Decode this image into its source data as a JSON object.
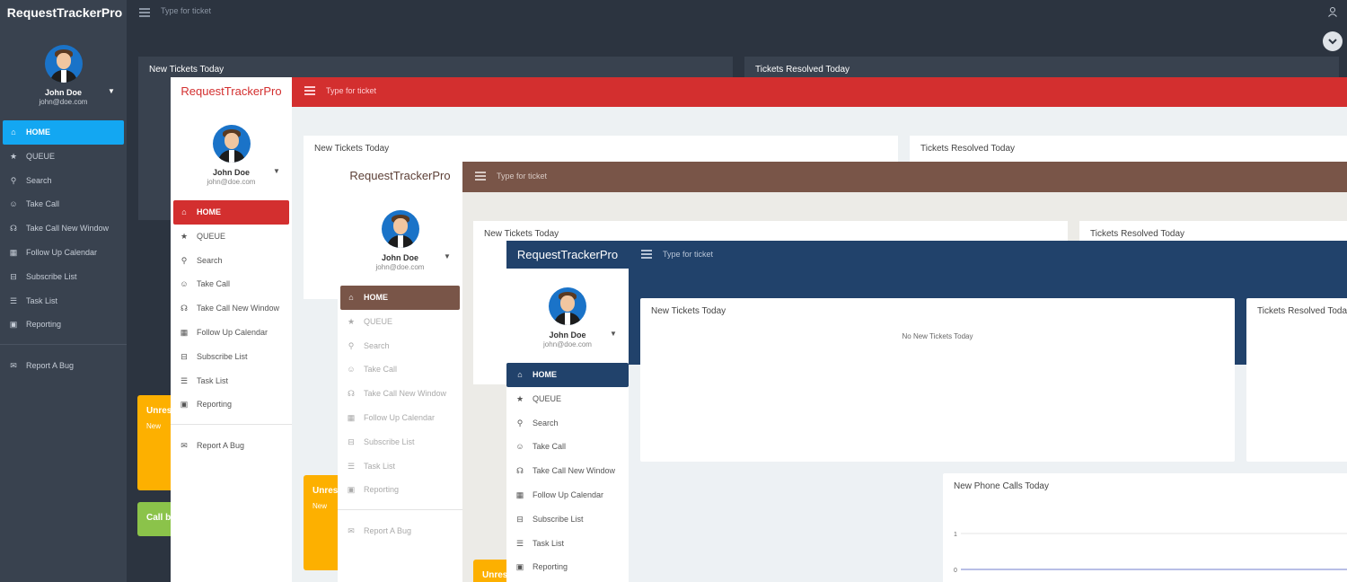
{
  "app": {
    "title": "RequestTrackerPro",
    "search_placeholder": "Type for ticket"
  },
  "user": {
    "name": "John Doe",
    "email": "john@doe.com"
  },
  "nav": {
    "items": [
      {
        "label": "HOME",
        "icon": "home-icon"
      },
      {
        "label": "QUEUE",
        "icon": "star-icon"
      },
      {
        "label": "Search",
        "icon": "search-icon"
      },
      {
        "label": "Take Call",
        "icon": "user-icon"
      },
      {
        "label": "Take Call New Window",
        "icon": "headset-icon"
      },
      {
        "label": "Follow Up Calendar",
        "icon": "calendar-icon"
      },
      {
        "label": "Subscribe List",
        "icon": "inbox-icon"
      },
      {
        "label": "Task List",
        "icon": "list-icon"
      },
      {
        "label": "Reporting",
        "icon": "briefcase-icon"
      }
    ],
    "report_bug": "Report A Bug"
  },
  "cards": {
    "new_tickets_title": "New Tickets Today",
    "resolved_title": "Tickets Resolved Today",
    "no_new_tickets": "No New Tickets Today",
    "phone_calls_title": "New Phone Calls Today",
    "unresolved_prefix": "Unres",
    "unresolved_sub": "New",
    "call_prefix": "Call b"
  },
  "chart_data": {
    "type": "line",
    "title": "New Phone Calls Today",
    "y_ticks": [
      "1",
      "0"
    ],
    "ylim": [
      0,
      1
    ],
    "series": [
      {
        "values": [
          0,
          0
        ]
      }
    ]
  },
  "themes": {
    "dark": {
      "bg": "#2c3440",
      "accent": "#13a7f2"
    },
    "red": {
      "accent": "#d32f2f"
    },
    "brown": {
      "accent": "#795548"
    },
    "blue": {
      "accent": "#21426b"
    }
  }
}
